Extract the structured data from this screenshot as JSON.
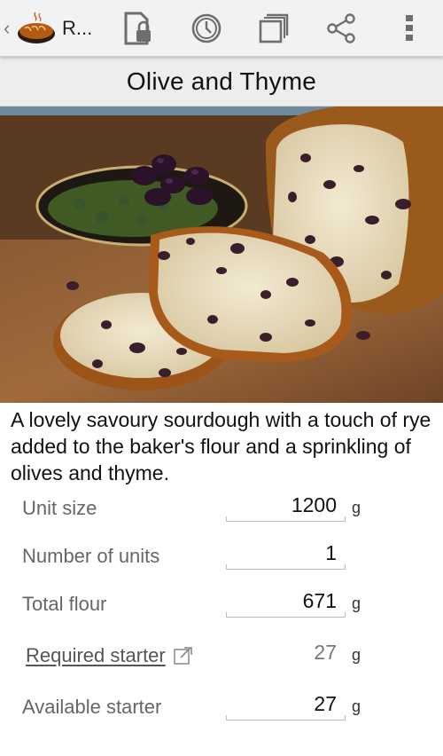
{
  "app": {
    "up_glyph": "‹",
    "title": "R...",
    "logo_icon": "bread-loaf-logo",
    "actions": [
      "lock-document-icon",
      "timer-icon",
      "copy-icon",
      "share-icon",
      "overflow-menu-icon"
    ]
  },
  "recipe": {
    "title": "Olive and Thyme",
    "photo": "olive-bread-photo",
    "description": "A lovely savoury sourdough with a touch of rye added to the baker's flour and a sprinkling of olives and thyme."
  },
  "fields": {
    "unit_size": {
      "label": "Unit size",
      "value": "1200",
      "unit": "g"
    },
    "number_of_units": {
      "label": "Number of units",
      "value": "1"
    },
    "total_flour": {
      "label": "Total flour",
      "value": "671",
      "unit": "g"
    },
    "required_starter": {
      "label": "Required starter",
      "value": "27",
      "unit": "g",
      "link_icon": "open-external-icon"
    },
    "available_starter": {
      "label": "Available starter",
      "value": "27",
      "unit": "g"
    }
  },
  "colors": {
    "appbar_bg": "#f2f2f2",
    "title_bar_bg": "#ededed",
    "label_gray": "#666666"
  }
}
